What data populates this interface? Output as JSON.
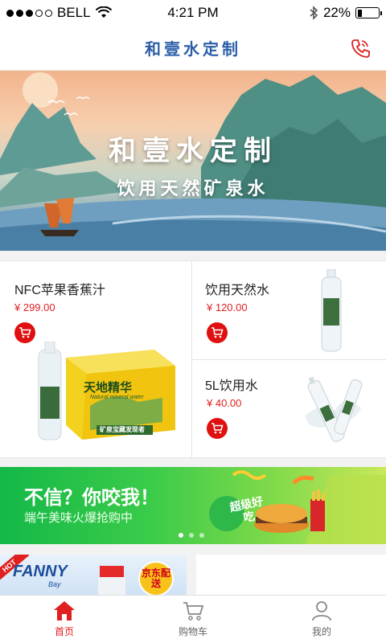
{
  "status_bar": {
    "carrier": "BELL",
    "time": "4:21 PM",
    "battery": "22%",
    "battery_level": 0.22,
    "icons": [
      "signal-dots",
      "wifi-icon",
      "bluetooth-icon",
      "battery-icon"
    ]
  },
  "header": {
    "title": "和壹水定制",
    "call_icon": "phone-icon"
  },
  "banner": {
    "title": "和壹水定制",
    "subtitle": "饮用天然矿泉水"
  },
  "products": [
    {
      "name": "NFC苹果香蕉汁",
      "price": "¥ 299.00",
      "box_text": "天地精华",
      "box_sub": "Natural mineral water",
      "box_tag": "矿泉宝藏发现者"
    },
    {
      "name": "饮用天然水",
      "price": "¥ 120.00"
    },
    {
      "name": "5L饮用水",
      "price": "¥ 40.00"
    }
  ],
  "promo": {
    "title": "不信？你咬我！",
    "subtitle": "端午美味火爆抢购中",
    "badge": "超级好吃",
    "dots": 3,
    "active_dot": 0
  },
  "bottom_tiles": {
    "left_brand": "FANNY",
    "left_brand_sub": "Bay",
    "left_tag": "HOT",
    "left_badge": "京东配送"
  },
  "tab_bar": {
    "items": [
      {
        "label": "首页",
        "icon": "home-icon",
        "active": true
      },
      {
        "label": "购物车",
        "icon": "cart-icon",
        "active": false
      },
      {
        "label": "我的",
        "icon": "user-icon",
        "active": false
      }
    ]
  },
  "colors": {
    "accent": "#e02020",
    "title_blue": "#2c5fa8",
    "promo_green": "#14b847"
  }
}
